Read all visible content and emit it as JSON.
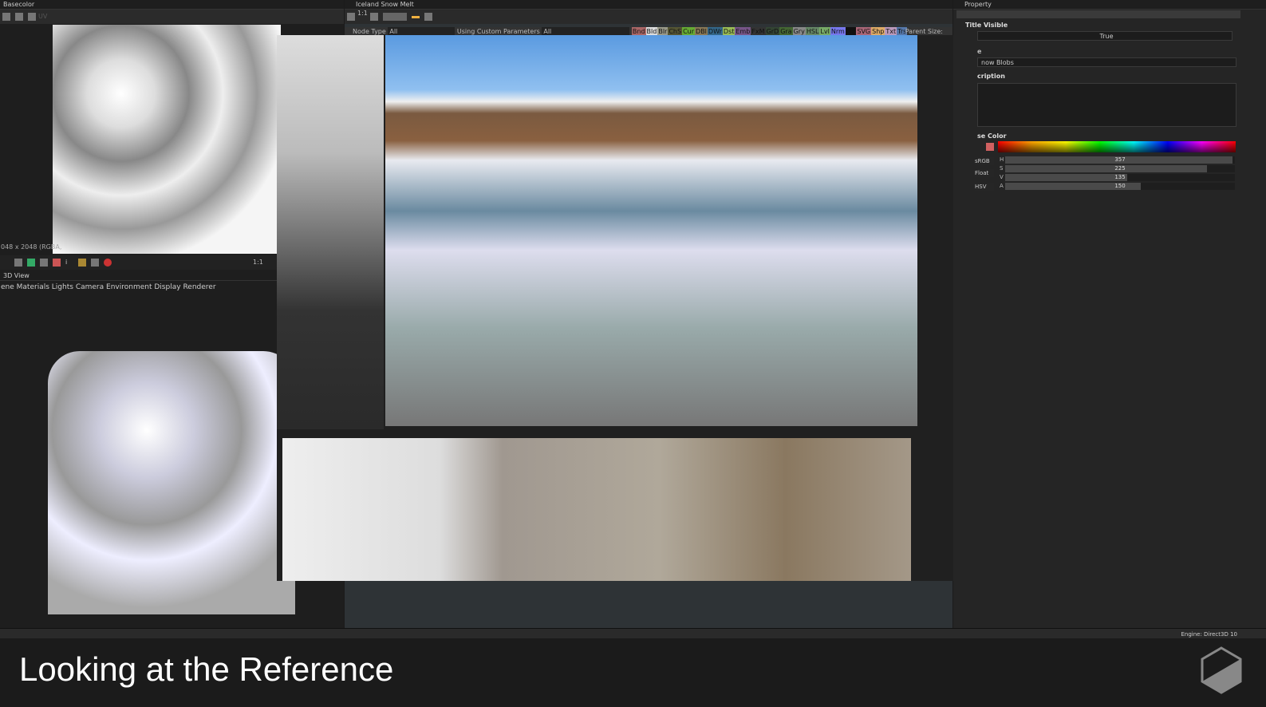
{
  "left_panel": {
    "title": "Basecolor",
    "uv_label": "UV",
    "image_info": "048 x 2048 (RGBA,",
    "zoom_label": "1:1",
    "view_title": "3D View",
    "menu": [
      "ene",
      "Materials",
      "Lights",
      "Camera",
      "Environment",
      "Display",
      "Renderer"
    ]
  },
  "graph_panel": {
    "title": "Iceland Snow Melt",
    "zoom_label": "1:1",
    "node_type_label": "Node Type",
    "node_type_value": "All",
    "custom_params_label": "Using Custom Parameters",
    "custom_params_value": "All",
    "filters": [
      "Bnd",
      "Bld",
      "Blr",
      "ChS",
      "Cur",
      "DBl",
      "DWr",
      "Dst",
      "Emb",
      "FxM",
      "GrD",
      "Gra",
      "Gry",
      "HSL",
      "Lvl",
      "Nrm",
      "Pix",
      "SVG",
      "Shp",
      "Txt",
      "Trs"
    ],
    "parent_size_label": "Parent Size:"
  },
  "property_panel": {
    "title": "Property",
    "title_visible_label": "Title Visible",
    "title_visible_value": "True",
    "label_heading": "e",
    "label_value": "now Blobs",
    "description_heading": "cription",
    "color_heading": "se Color",
    "mode_buttons": [
      "sRGB",
      "Float",
      "HSV"
    ],
    "sliders": [
      {
        "label": "H",
        "value": 357,
        "fraction": 0.99
      },
      {
        "label": "S",
        "value": 225,
        "fraction": 0.88
      },
      {
        "label": "V",
        "value": 135,
        "fraction": 0.53
      },
      {
        "label": "A",
        "value": 150,
        "fraction": 0.59
      }
    ]
  },
  "status": {
    "engine": "Engine: Direct3D 10"
  },
  "caption": {
    "text": "Looking at the Reference"
  },
  "colors": {
    "accent": "#f0b040",
    "swatch": "#d06060"
  }
}
